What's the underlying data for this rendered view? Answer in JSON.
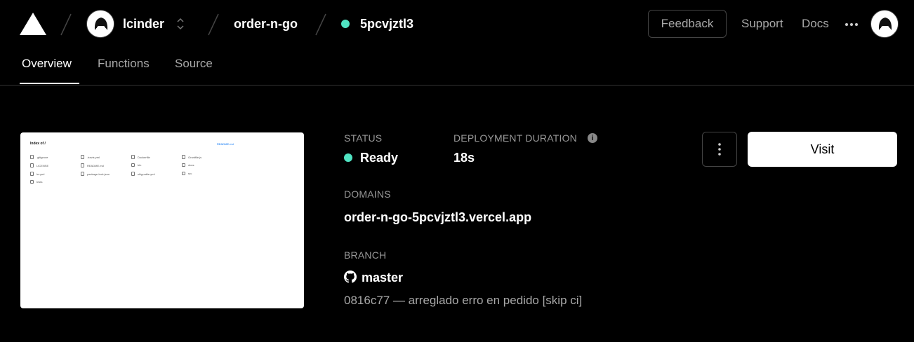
{
  "header": {
    "team": "lcinder",
    "project": "order-n-go",
    "deployment_id": "5pcvjztl3",
    "feedback_label": "Feedback",
    "support_label": "Support",
    "docs_label": "Docs"
  },
  "tabs": [
    {
      "label": "Overview",
      "active": true
    },
    {
      "label": "Functions",
      "active": false
    },
    {
      "label": "Source",
      "active": false
    }
  ],
  "preview": {
    "title": "Index of /",
    "readme_link": "README.md",
    "files": [
      [
        ".gitignore",
        "LICENSE",
        "lcr.yml",
        "tests"
      ],
      [
        ".travis.yml",
        "README.md",
        "package-lock.json"
      ],
      [
        "Dockerfile",
        "bin",
        "shippable.yml"
      ],
      [
        "Gruntfile.js",
        "docs",
        "src"
      ]
    ]
  },
  "status": {
    "label": "STATUS",
    "value": "Ready",
    "color": "#50e3c2"
  },
  "duration": {
    "label": "DEPLOYMENT DURATION",
    "value": "18s"
  },
  "domains": {
    "label": "DOMAINS",
    "value": "order-n-go-5pcvjztl3.vercel.app"
  },
  "branch": {
    "label": "BRANCH",
    "value": "master",
    "commit": "0816c77 — arreglado erro en pedido [skip ci]"
  },
  "actions": {
    "visit_label": "Visit"
  },
  "icons": {
    "logo": "vercel-triangle-icon",
    "more": "ellipsis-icon",
    "info": "info-icon",
    "github": "github-icon",
    "menu": "vertical-ellipsis-icon"
  }
}
